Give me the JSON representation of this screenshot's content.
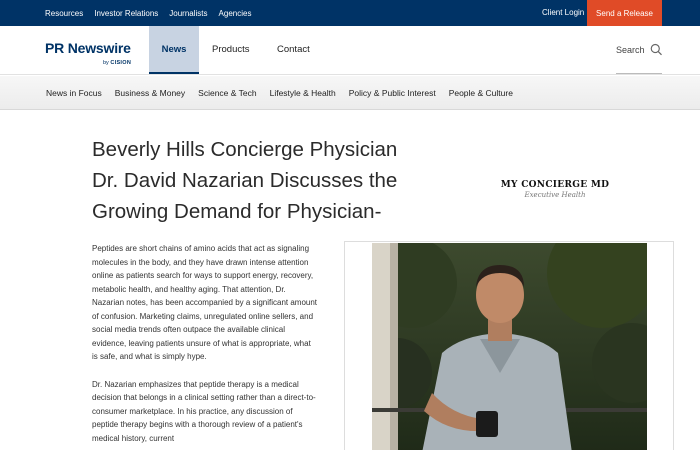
{
  "topbar": {
    "links": [
      "Resources",
      "Investor Relations",
      "Journalists",
      "Agencies"
    ],
    "client_login": "Client Login",
    "send_release": "Send a Release"
  },
  "logo": {
    "brand": "PR Newswire",
    "by": "by",
    "parent": "CISION"
  },
  "mainnav": {
    "news": "News",
    "products": "Products",
    "contact": "Contact",
    "search_label": "Search"
  },
  "catnav": {
    "items": [
      "News in Focus",
      "Business & Money",
      "Science & Tech",
      "Lifestyle & Health",
      "Policy & Public Interest",
      "People & Culture"
    ]
  },
  "article": {
    "headline_lines": [
      "Beverly Hills Concierge Physician",
      "Dr. David Nazarian Discusses the",
      "Growing Demand for Physician-"
    ],
    "paragraphs": [
      "Peptides are short chains of amino acids that act as signaling molecules in the body, and they have drawn intense attention online as patients search for ways to support energy, recovery, metabolic health, and healthy aging. That attention, Dr. Nazarian notes, has been accompanied by a significant amount of confusion. Marketing claims, unregulated online sellers, and social media trends often outpace the available clinical evidence, leaving patients unsure of what is appropriate, what is safe, and what is simply hype.",
      "Dr. Nazarian emphasizes that peptide therapy is a medical decision that belongs in a clinical setting rather than a direct-to-consumer marketplace. In his practice, any discussion of peptide therapy begins with a thorough review of a patient's medical history, current"
    ]
  },
  "sidebar": {
    "logo_name": "MY CONCIERGE MD",
    "logo_tagline": "Executive Health"
  },
  "icons": {
    "search": "search-icon"
  },
  "colors": {
    "topbar_bg": "#003366",
    "cta_bg": "#e04b27",
    "active_nav_bg": "#c8d3e2",
    "brand_blue": "#003366"
  }
}
